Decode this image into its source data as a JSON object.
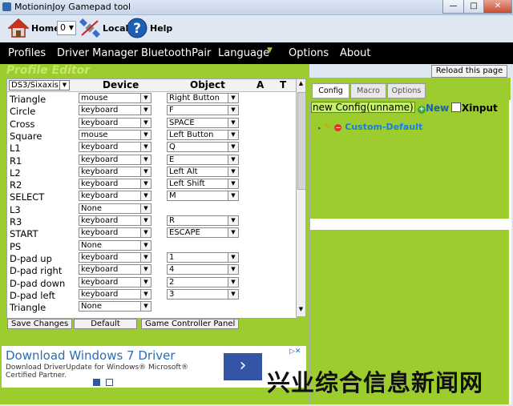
{
  "window": {
    "title": "MotioninJoy Gamepad tool"
  },
  "toolbar": {
    "home_label": "Home",
    "combo_value": "0",
    "local_label": "Local",
    "help_label": "Help"
  },
  "menu": [
    "Profiles",
    "Driver Manager",
    "BluetoothPair",
    "Language",
    "Options",
    "About"
  ],
  "editor": {
    "title": "Profile Editor",
    "reload_label": "Reload this page",
    "device_select": "DS3/Sixaxis",
    "columns": {
      "device": "Device",
      "object": "Object",
      "a": "A",
      "t": "T"
    },
    "rows": [
      {
        "button": "Triangle",
        "device": "mouse",
        "object": "Right Button"
      },
      {
        "button": "Circle",
        "device": "keyboard",
        "object": "F"
      },
      {
        "button": "Cross",
        "device": "keyboard",
        "object": "SPACE"
      },
      {
        "button": "Square",
        "device": "mouse",
        "object": "Left Button"
      },
      {
        "button": "L1",
        "device": "keyboard",
        "object": "Q"
      },
      {
        "button": "R1",
        "device": "keyboard",
        "object": "E"
      },
      {
        "button": "L2",
        "device": "keyboard",
        "object": "Left Alt"
      },
      {
        "button": "R2",
        "device": "keyboard",
        "object": "Left Shift"
      },
      {
        "button": "SELECT",
        "device": "keyboard",
        "object": "M"
      },
      {
        "button": "L3",
        "device": "None",
        "object": ""
      },
      {
        "button": "R3",
        "device": "keyboard",
        "object": "R"
      },
      {
        "button": "START",
        "device": "keyboard",
        "object": "ESCAPE"
      },
      {
        "button": "PS",
        "device": "None",
        "object": ""
      },
      {
        "button": "D-pad up",
        "device": "keyboard",
        "object": "1"
      },
      {
        "button": "D-pad right",
        "device": "keyboard",
        "object": "4"
      },
      {
        "button": "D-pad down",
        "device": "keyboard",
        "object": "2"
      },
      {
        "button": "D-pad left",
        "device": "keyboard",
        "object": "3"
      },
      {
        "button": "Triangle",
        "device": "None",
        "object": ""
      }
    ],
    "buttons": {
      "save": "Save Changes",
      "default": "Default",
      "panel": "Game Controller Panel"
    }
  },
  "ad": {
    "headline": "Download Windows 7 Driver",
    "body": "Download DriverUpdate for Windows® Microsoft® Certified Partner.",
    "choices": "▷✕"
  },
  "config": {
    "tabs": [
      "Config",
      "Macro",
      "Options"
    ],
    "name_input": "new Config(unname)",
    "new_label": "New",
    "xinput_label": "Xinput",
    "tree_item": "Custom-Default"
  },
  "watermark": "兴业综合信息新闻网",
  "colors": {
    "panel_green": "#9ccc2e",
    "menu_bg": "#000000",
    "link_blue": "#2a6db3"
  }
}
